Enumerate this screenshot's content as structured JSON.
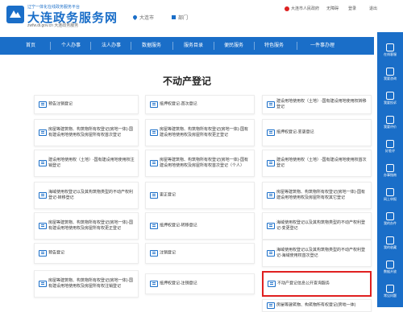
{
  "header": {
    "tagline": "辽宁一体化在线政务服务平台",
    "title": "大连政务服务网",
    "url_text": "zwfw.dl.gov.cn  大连政务服务",
    "location": "大连市",
    "department": "部门",
    "gov_link": "大连市人民政府",
    "accessibility": "无障碍",
    "login": "登录",
    "logout": "退出"
  },
  "nav": {
    "items": [
      "首页",
      "个人办事",
      "法人办事",
      "数据服务",
      "服务目录",
      "便民服务",
      "特色服务",
      "一件事办理"
    ]
  },
  "page_title": "不动产登记",
  "cards": [
    "预告注销登记",
    "抵押权登记-首次登记",
    "建设用地使用权（土地）-国有建设用地使用权转移登记",
    "房屋等建筑物、构筑物所有权登记(房地一体)-国有建设用地使用权及房屋所有权首次登记",
    "房屋等建筑物、构筑物所有权登记(房地一体)-国有建设用地使用权及房屋所有权更正登记",
    "抵押权登记-变更登记",
    "建设用地使用权（土地）-国有建设用地使用权注销登记",
    "房屋等建筑物、构筑物所有权登记(房地一体)-国有建设用地使用权及房屋所有权首次登记（个人）",
    "建设用地使用权（土地）-国有建设用地使用权首次登记",
    "海域使用权登记以及其构筑物类型的不动产权利登记-转移登记",
    "更正登记",
    "房屋等建筑物、构筑物所有权登记(房地一体)-国有建设用地使用权及房屋所有权其它登记",
    "房屋等建筑物、构筑物所有权登记(房地一体)-国有建设用地使用权及房屋所有权更正登记",
    "抵押权登记-转移登记",
    "海域使用权登记以及其构筑物类型的不动产权利登记-变更登记",
    "预告登记",
    "注销登记",
    "海域使用权登记以及其构筑物类型的不动产权利登记-海域使用权首次登记",
    "房屋等建筑物、构筑物所有权登记(房地一体)-国有建设用地使用权及房屋所有权注销登记",
    "抵押权登记-注销登记",
    "不动产登记信息公开查询服务",
    "房屋等建筑物、构筑物所有权登记(房地一体)"
  ],
  "sidebar": {
    "items": [
      "在线客服",
      "我要咨询",
      "我要投诉",
      "我要评价",
      "好差评",
      "办事指南",
      "网上申报",
      "我的办件",
      "我的收藏",
      "数据开放",
      "常见问题"
    ]
  },
  "accent": "#1a6ec8",
  "highlight": "#e02020"
}
